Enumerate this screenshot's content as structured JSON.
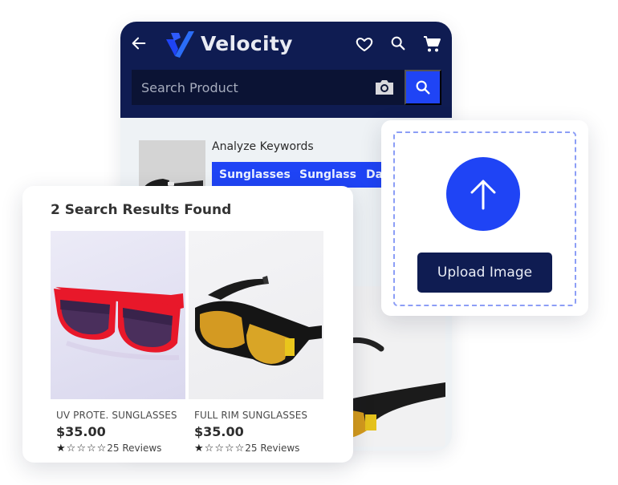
{
  "app": {
    "brand_name": "Velocity",
    "colors": {
      "header_bg": "#0f1c52",
      "accent": "#1f44f5",
      "dropzone_border": "#8c9ef6"
    }
  },
  "header": {
    "icons": [
      "back-arrow-icon",
      "velocity-logo-icon",
      "heart-icon",
      "search-icon",
      "cart-icon"
    ]
  },
  "search": {
    "placeholder": "Search Product",
    "value": "",
    "camera_icon": "camera-icon",
    "button_icon": "search-icon"
  },
  "analyze": {
    "label": "Analyze Keywords",
    "keywords": [
      "Sunglasses",
      "Sunglass",
      "Da"
    ]
  },
  "results": {
    "title": "2 Search Results Found",
    "products": [
      {
        "name": "UV PROTE. SUNGLASSES",
        "price": "$35.00",
        "rating": 1,
        "max_rating": 5,
        "reviews": "25 Reviews"
      },
      {
        "name": "FULL RIM SUNGLASSES",
        "price": "$35.00",
        "rating": 1,
        "max_rating": 5,
        "reviews": "25 Reviews"
      }
    ]
  },
  "upload": {
    "icon": "upload-arrow-icon",
    "button_label": "Upload Image"
  }
}
